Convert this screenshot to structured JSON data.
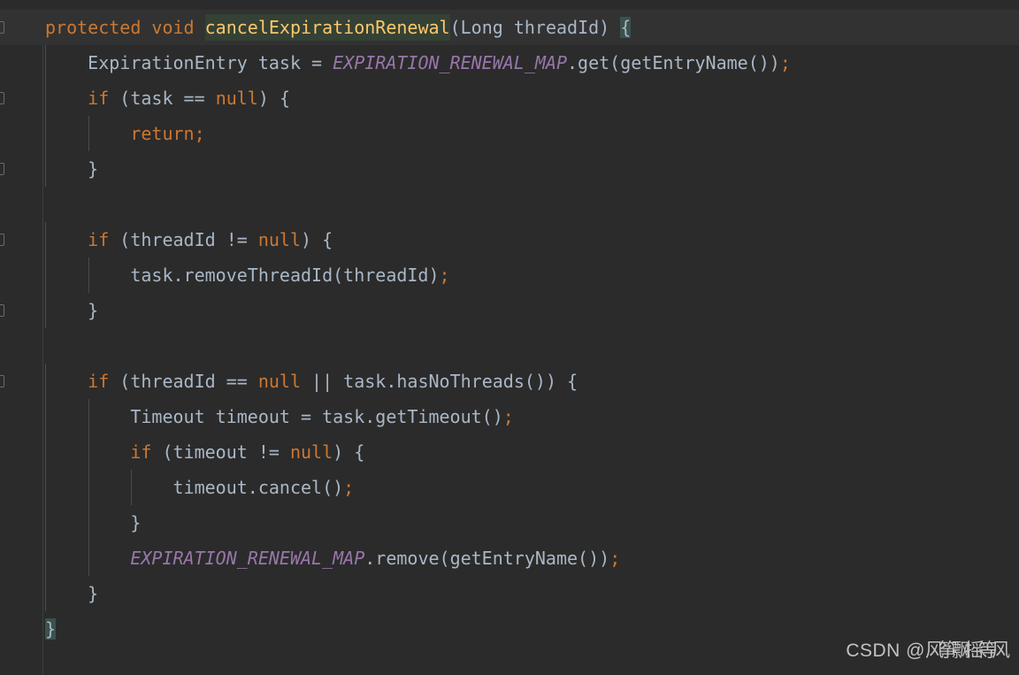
{
  "theme": {
    "name": "darcula",
    "background": "#2b2b2b",
    "current_line_background": "#323232",
    "gutter_background": "#2b2b2b",
    "gutter_divider": "#3c3f41",
    "indent_guide": "#4b4b4b",
    "default_text": "#a9b7c6",
    "keyword": "#cc7832",
    "method_declaration": "#ffc66d",
    "static_field": "#9876aa",
    "identifier_highlight_background": "#344134",
    "brace_match_background": "#3b514d"
  },
  "editor": {
    "language": "java",
    "caret_line": 1,
    "highlighted_symbol": "cancelExpirationRenewal",
    "lines": [
      {
        "n": 1,
        "indent": 0,
        "current": true,
        "fold_marker": true,
        "tokens": [
          {
            "t": "protected",
            "c": "kw"
          },
          {
            "t": " ",
            "c": "plain"
          },
          {
            "t": "void",
            "c": "kw"
          },
          {
            "t": " ",
            "c": "plain"
          },
          {
            "t": "cancelExpirationRenewal",
            "c": "method name-hl"
          },
          {
            "t": "(Long threadId) ",
            "c": "plain"
          },
          {
            "t": "{",
            "c": "plain brace-hl"
          }
        ]
      },
      {
        "n": 2,
        "indent": 1,
        "current": false,
        "fold_marker": false,
        "tokens": [
          {
            "t": "    ExpirationEntry task = ",
            "c": "plain"
          },
          {
            "t": "EXPIRATION_RENEWAL_MAP",
            "c": "static"
          },
          {
            "t": ".get(getEntryName())",
            "c": "plain"
          },
          {
            "t": ";",
            "c": "semi"
          }
        ]
      },
      {
        "n": 3,
        "indent": 1,
        "current": false,
        "fold_marker": true,
        "tokens": [
          {
            "t": "    ",
            "c": "plain"
          },
          {
            "t": "if",
            "c": "kw"
          },
          {
            "t": " (task == ",
            "c": "plain"
          },
          {
            "t": "null",
            "c": "kw"
          },
          {
            "t": ") {",
            "c": "plain"
          }
        ]
      },
      {
        "n": 4,
        "indent": 2,
        "current": false,
        "fold_marker": false,
        "tokens": [
          {
            "t": "        ",
            "c": "plain"
          },
          {
            "t": "return",
            "c": "kw"
          },
          {
            "t": ";",
            "c": "semi"
          }
        ]
      },
      {
        "n": 5,
        "indent": 1,
        "current": false,
        "fold_marker": true,
        "tokens": [
          {
            "t": "    }",
            "c": "plain"
          }
        ]
      },
      {
        "n": 6,
        "indent": 0,
        "current": false,
        "fold_marker": false,
        "tokens": [
          {
            "t": "",
            "c": "plain"
          }
        ]
      },
      {
        "n": 7,
        "indent": 1,
        "current": false,
        "fold_marker": true,
        "tokens": [
          {
            "t": "    ",
            "c": "plain"
          },
          {
            "t": "if",
            "c": "kw"
          },
          {
            "t": " (threadId != ",
            "c": "plain"
          },
          {
            "t": "null",
            "c": "kw"
          },
          {
            "t": ") {",
            "c": "plain"
          }
        ]
      },
      {
        "n": 8,
        "indent": 2,
        "current": false,
        "fold_marker": false,
        "tokens": [
          {
            "t": "        task.removeThreadId(threadId)",
            "c": "plain"
          },
          {
            "t": ";",
            "c": "semi"
          }
        ]
      },
      {
        "n": 9,
        "indent": 1,
        "current": false,
        "fold_marker": true,
        "tokens": [
          {
            "t": "    }",
            "c": "plain"
          }
        ]
      },
      {
        "n": 10,
        "indent": 0,
        "current": false,
        "fold_marker": false,
        "tokens": [
          {
            "t": "",
            "c": "plain"
          }
        ]
      },
      {
        "n": 11,
        "indent": 1,
        "current": false,
        "fold_marker": true,
        "tokens": [
          {
            "t": "    ",
            "c": "plain"
          },
          {
            "t": "if",
            "c": "kw"
          },
          {
            "t": " (threadId == ",
            "c": "plain"
          },
          {
            "t": "null",
            "c": "kw"
          },
          {
            "t": " || task.hasNoThreads()) {",
            "c": "plain"
          }
        ]
      },
      {
        "n": 12,
        "indent": 2,
        "current": false,
        "fold_marker": false,
        "tokens": [
          {
            "t": "        Timeout timeout = task.getTimeout()",
            "c": "plain"
          },
          {
            "t": ";",
            "c": "semi"
          }
        ]
      },
      {
        "n": 13,
        "indent": 2,
        "current": false,
        "fold_marker": false,
        "tokens": [
          {
            "t": "        ",
            "c": "plain"
          },
          {
            "t": "if",
            "c": "kw"
          },
          {
            "t": " (timeout != ",
            "c": "plain"
          },
          {
            "t": "null",
            "c": "kw"
          },
          {
            "t": ") {",
            "c": "plain"
          }
        ]
      },
      {
        "n": 14,
        "indent": 3,
        "current": false,
        "fold_marker": false,
        "tokens": [
          {
            "t": "            timeout.cancel()",
            "c": "plain"
          },
          {
            "t": ";",
            "c": "semi"
          }
        ]
      },
      {
        "n": 15,
        "indent": 2,
        "current": false,
        "fold_marker": false,
        "tokens": [
          {
            "t": "        }",
            "c": "plain"
          }
        ]
      },
      {
        "n": 16,
        "indent": 2,
        "current": false,
        "fold_marker": false,
        "tokens": [
          {
            "t": "        ",
            "c": "plain"
          },
          {
            "t": "EXPIRATION_RENEWAL_MAP",
            "c": "static"
          },
          {
            "t": ".remove(getEntryName())",
            "c": "plain"
          },
          {
            "t": ";",
            "c": "semi"
          }
        ]
      },
      {
        "n": 17,
        "indent": 1,
        "current": false,
        "fold_marker": false,
        "tokens": [
          {
            "t": "    }",
            "c": "plain"
          }
        ]
      },
      {
        "n": 18,
        "indent": 0,
        "current": false,
        "fold_marker": false,
        "tokens": [
          {
            "t": "}",
            "c": "plain brace-hl"
          }
        ]
      }
    ]
  },
  "watermark": {
    "prefix": "CSDN @",
    "username": "风筝飘摇等风"
  }
}
